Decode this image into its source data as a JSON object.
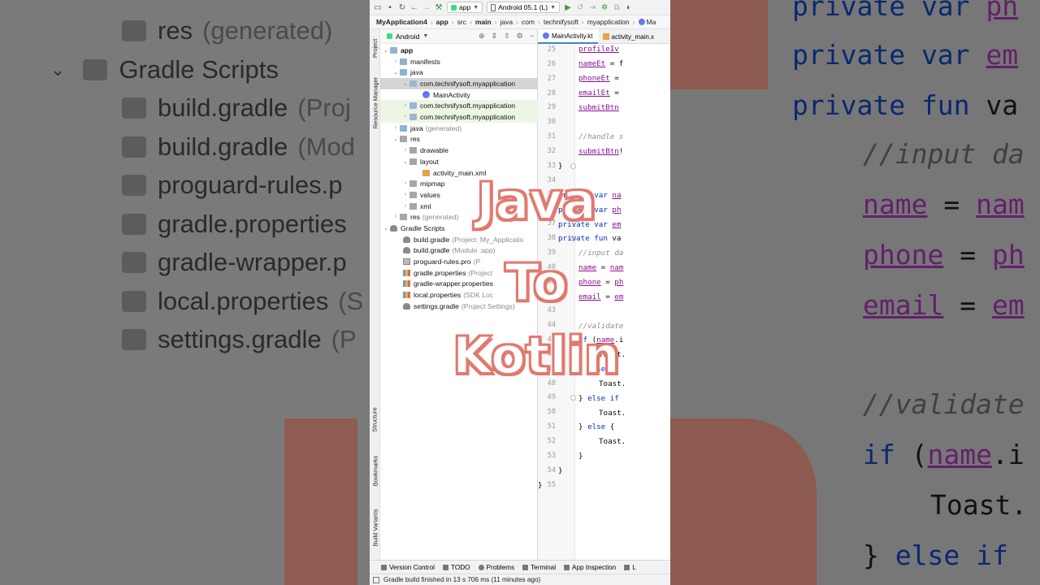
{
  "toolbar": {
    "run_config": "app",
    "device": "Android 05.1 (L)"
  },
  "breadcrumb": [
    "MyApplication4",
    "app",
    "src",
    "main",
    "java",
    "com",
    "technifysoft",
    "myapplication",
    "Ma"
  ],
  "left_stripe": {
    "top": [
      "Project",
      "Resource Manager"
    ],
    "bottom": [
      "Structure",
      "Bookmarks",
      "Build Variants"
    ]
  },
  "project_panel": {
    "view_mode": "Android"
  },
  "tree": [
    {
      "label": "app",
      "bold": true
    },
    {
      "label": "manifests"
    },
    {
      "label": "java"
    },
    {
      "label": "com.technifysoft.myapplication"
    },
    {
      "label": "MainActivity"
    },
    {
      "label": "com.technifysoft.myapplication"
    },
    {
      "label": "com.technifysoft.myapplication"
    },
    {
      "label": "java",
      "note": "(generated)"
    },
    {
      "label": "res"
    },
    {
      "label": "drawable"
    },
    {
      "label": "layout"
    },
    {
      "label": "activity_main.xml"
    },
    {
      "label": "mipmap"
    },
    {
      "label": "values"
    },
    {
      "label": "xml"
    },
    {
      "label": "res",
      "note": "(generated)"
    },
    {
      "label": "Gradle Scripts"
    },
    {
      "label": "build.gradle",
      "note": "(Project: My_Applicatio"
    },
    {
      "label": "build.gradle",
      "note": "(Module :app)"
    },
    {
      "label": "proguard-rules.pro",
      "note": "(P"
    },
    {
      "label": "gradle.properties",
      "note": "(Project"
    },
    {
      "label": "gradle-wrapper.properties",
      "note": ""
    },
    {
      "label": "local.properties",
      "note": "(SDK Loc"
    },
    {
      "label": "settings.gradle",
      "note": "(Project Settings)"
    }
  ],
  "editor_tabs": [
    "MainActivity.kt",
    "activity_main.x"
  ],
  "line_numbers": [
    "25",
    "26",
    "27",
    "28",
    "29",
    "30",
    "31",
    "32",
    "33",
    "34",
    "35",
    "36",
    "37",
    "38",
    "39",
    "40",
    "41",
    "42",
    "43",
    "44",
    "45",
    "46",
    "47",
    "48",
    "49",
    "50",
    "51",
    "52",
    "53",
    "54",
    "55"
  ],
  "code": {
    "l25": "profileIv",
    "l26_id": "nameEt",
    "l26_rest": " = f",
    "l27_id": "phoneEt",
    "l27_rest": " =",
    "l28_id": "emailEt",
    "l28_rest": " =",
    "l29": "submitBtn",
    "l31": "//handle s",
    "l32_id": "submitBtn",
    "l32_rest": "!",
    "l33": "}",
    "l35_kw": "private var",
    "l35_id": "na",
    "l36_kw": "private var",
    "l36_id": "ph",
    "l37_kw": "private var",
    "l37_id": "em",
    "l38_kw": "private fun",
    "l38_rest": " va",
    "l39": "//input da",
    "l40_id": "name",
    "l40_rest": " = ",
    "l40_id2": "nam",
    "l41_id": "phone",
    "l41_rest": " = ",
    "l41_id2": "ph",
    "l42_id": "email",
    "l42_rest": " = ",
    "l42_id2": "em",
    "l44": "//validate",
    "l45_kw": "if",
    "l45_rest": " (",
    "l45_id": "name",
    "l45_tail": ".i",
    "l46": "Toast.",
    "l47_a": "} ",
    "l47_kw": "else if",
    "l48": "Toast.",
    "l49_a": "} ",
    "l49_kw": "else if",
    "l50": "Toast.",
    "l51_a": "} ",
    "l51_kw": "else",
    "l51_b": " {",
    "l52": "Toast.",
    "l53": "}",
    "l54": "}",
    "l55": "}"
  },
  "bottom_tabs": [
    "Version Control",
    "TODO",
    "Problems",
    "Terminal",
    "App Inspection",
    "L"
  ],
  "status": "Gradle build finished in 13 s 706 ms (11 minutes ago)",
  "overlay": [
    "Java",
    "To",
    "Kotlin"
  ],
  "background_left": [
    {
      "label": "res",
      "note": "(generated)"
    },
    {
      "label": "Gradle Scripts",
      "note": ""
    },
    {
      "label": "build.gradle",
      "note": "(Proj"
    },
    {
      "label": "build.gradle",
      "note": "(Mod"
    },
    {
      "label": "proguard-rules.p",
      "note": ""
    },
    {
      "label": "gradle.properties",
      "note": ""
    },
    {
      "label": "gradle-wrapper.p",
      "note": ""
    },
    {
      "label": "local.properties",
      "note": "(S"
    },
    {
      "label": "settings.gradle",
      "note": "(P"
    }
  ],
  "background_right": {
    "r1_kw": "private var",
    "r1_id": "ph",
    "r2_kw": "private var",
    "r2_id": "em",
    "r3_kw": "private fun",
    "r3_rest": " va",
    "r4": "//input da",
    "r5_id": "name",
    "r5_rest": " = ",
    "r5_id2": "nam",
    "r6_id": "phone",
    "r6_rest": " = ",
    "r6_id2": "ph",
    "r7_id": "email",
    "r7_rest": " = ",
    "r7_id2": "em",
    "r8": "//validate",
    "r9_kw": "if",
    "r9_rest": " (",
    "r9_id": "name",
    "r9_tail": ".i",
    "r10": "Toast.",
    "r11_a": "} ",
    "r11_kw": "else if"
  },
  "colors": {
    "keyword": "#0033b3",
    "identifier": "#871094",
    "comment": "#8c8c8c",
    "overlay_outline": "#e07a6f",
    "selection": "#d5d5d5",
    "vcs_added": "#edf6e4"
  }
}
